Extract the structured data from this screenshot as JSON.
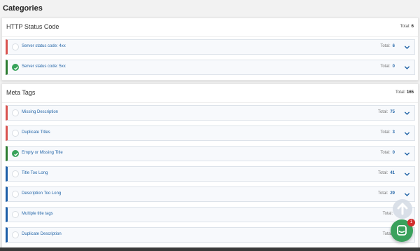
{
  "page": {
    "title": "Categories"
  },
  "total_label": "Total:",
  "categories": [
    {
      "title": "HTTP Status Code",
      "total": "6",
      "items": [
        {
          "label": "Server status code: 4xx",
          "total": "6",
          "accent": "red",
          "done": false
        },
        {
          "label": "Server status code: 5xx",
          "total": "0",
          "accent": "green",
          "done": true
        }
      ]
    },
    {
      "title": "Meta Tags",
      "total": "165",
      "items": [
        {
          "label": "Missing Description",
          "total": "75",
          "accent": "red",
          "done": false
        },
        {
          "label": "Duplicate Titles",
          "total": "3",
          "accent": "red",
          "done": false
        },
        {
          "label": "Empty or Missing Title",
          "total": "0",
          "accent": "green",
          "done": true
        },
        {
          "label": "Title Too Long",
          "total": "41",
          "accent": "blue",
          "done": false
        },
        {
          "label": "Description Too Long",
          "total": "29",
          "accent": "blue",
          "done": false
        },
        {
          "label": "Multiple title tags",
          "total": "",
          "accent": "blue",
          "done": false
        },
        {
          "label": "Duplicate Description",
          "total": "",
          "accent": "blue",
          "done": false
        }
      ]
    }
  ],
  "chat": {
    "badge": "1"
  },
  "colors": {
    "accent_red": "#d9534f",
    "accent_green": "#2e7d32",
    "accent_blue": "#1e5fa8",
    "link": "#2466a8",
    "chat": "#3aa15c"
  },
  "icons": {
    "status_done": "check-circle-icon",
    "status_pending": "empty-circle-icon",
    "expand": "chevron-down-icon",
    "scroll": "arrow-up-icon",
    "chat": "chat-icon"
  }
}
